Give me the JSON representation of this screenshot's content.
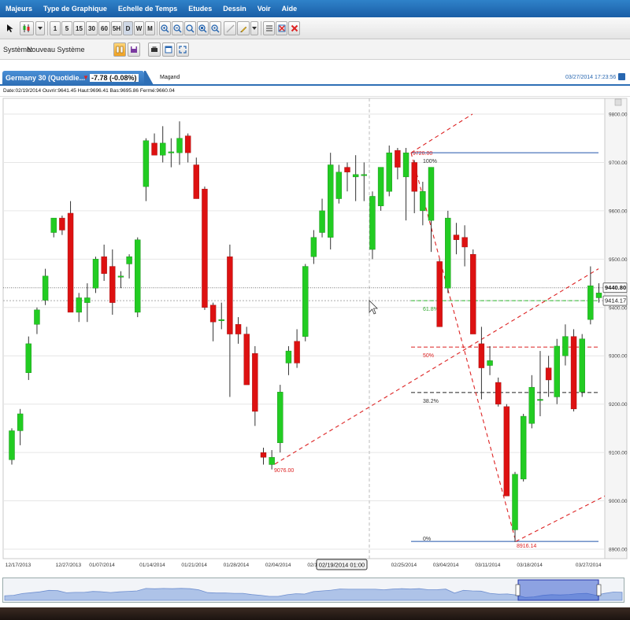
{
  "menu": [
    "Majeurs",
    "Type de Graphique",
    "Echelle de Temps",
    "Etudes",
    "Dessin",
    "Voir",
    "Aide"
  ],
  "toolbar": {
    "timeframes": [
      "1",
      "5",
      "15",
      "30",
      "60",
      "5H",
      "D",
      "W",
      "M"
    ]
  },
  "system": {
    "label": "Système:",
    "value": "Nouveau Système"
  },
  "tab": {
    "title": "Germany 30 (Quotidie...",
    "change": "-7.78 (-0.08%)",
    "second_tab": "Magand",
    "timestamp": "03/27/2014 17:23:56"
  },
  "info": {
    "text": "Date:02/19/2014 Ouvrir:9641.45 Haut:9696.41 Bas:9695.86 Fermé:9660.04"
  },
  "colors": {
    "up": "#22cc22",
    "down": "#dd1111",
    "fib": "#dd2222",
    "channel": "#2255aa"
  },
  "chart_data": {
    "type": "candlestick",
    "instrument": "Germany 30",
    "ylim": [
      8900,
      9800
    ],
    "y_ticks": [
      "9800.00",
      "9700.00",
      "9600.00",
      "9500.00",
      "9400.00",
      "9300.00",
      "9200.00",
      "9100.00",
      "9000.00",
      "8900.00"
    ],
    "x_ticks": [
      "12/17/2013",
      "12/27/2013",
      "01/07/2014",
      "01/14/2014",
      "01/21/2014",
      "01/28/2014",
      "02/04/2014",
      "02/11/2014",
      "02/25/2014",
      "03/04/2014",
      "03/11/2014",
      "03/18/2014",
      "03/27/2014"
    ],
    "candles": [
      {
        "o": 9085,
        "h": 9150,
        "l": 9075,
        "c": 9145
      },
      {
        "o": 9145,
        "h": 9190,
        "l": 9115,
        "c": 9180
      },
      {
        "o": 9265,
        "h": 9340,
        "l": 9250,
        "c": 9325
      },
      {
        "o": 9365,
        "h": 9400,
        "l": 9345,
        "c": 9395
      },
      {
        "o": 9415,
        "h": 9480,
        "l": 9405,
        "c": 9465
      },
      {
        "o": 9555,
        "h": 9585,
        "l": 9545,
        "c": 9585
      },
      {
        "o": 9585,
        "h": 9590,
        "l": 9550,
        "c": 9560
      },
      {
        "o": 9595,
        "h": 9620,
        "l": 9395,
        "c": 9390
      },
      {
        "o": 9390,
        "h": 9430,
        "l": 9370,
        "c": 9420
      },
      {
        "o": 9410,
        "h": 9450,
        "l": 9370,
        "c": 9420
      },
      {
        "o": 9440,
        "h": 9505,
        "l": 9430,
        "c": 9500
      },
      {
        "o": 9505,
        "h": 9530,
        "l": 9455,
        "c": 9470
      },
      {
        "o": 9485,
        "h": 9520,
        "l": 9385,
        "c": 9410
      },
      {
        "o": 9465,
        "h": 9475,
        "l": 9440,
        "c": 9465
      },
      {
        "o": 9490,
        "h": 9510,
        "l": 9460,
        "c": 9505
      },
      {
        "o": 9390,
        "h": 9545,
        "l": 9380,
        "c": 9540
      },
      {
        "o": 9650,
        "h": 9750,
        "l": 9620,
        "c": 9745
      },
      {
        "o": 9740,
        "h": 9760,
        "l": 9720,
        "c": 9715
      },
      {
        "o": 9715,
        "h": 9775,
        "l": 9700,
        "c": 9740
      },
      {
        "o": 9720,
        "h": 9750,
        "l": 9690,
        "c": 9722
      },
      {
        "o": 9720,
        "h": 9785,
        "l": 9695,
        "c": 9750
      },
      {
        "o": 9755,
        "h": 9760,
        "l": 9700,
        "c": 9720
      },
      {
        "o": 9695,
        "h": 9710,
        "l": 9625,
        "c": 9625
      },
      {
        "o": 9645,
        "h": 9650,
        "l": 9395,
        "c": 9400
      },
      {
        "o": 9405,
        "h": 9410,
        "l": 9330,
        "c": 9370
      },
      {
        "o": 9375,
        "h": 9410,
        "l": 9355,
        "c": 9375
      },
      {
        "o": 9505,
        "h": 9530,
        "l": 9215,
        "c": 9345
      },
      {
        "o": 9365,
        "h": 9380,
        "l": 9325,
        "c": 9345
      },
      {
        "o": 9345,
        "h": 9360,
        "l": 9265,
        "c": 9240
      },
      {
        "o": 9305,
        "h": 9320,
        "l": 9155,
        "c": 9185
      },
      {
        "o": 9100,
        "h": 9110,
        "l": 9075,
        "c": 9090
      },
      {
        "o": 9075,
        "h": 9105,
        "l": 9065,
        "c": 9090
      },
      {
        "o": 9120,
        "h": 9240,
        "l": 9100,
        "c": 9225
      },
      {
        "o": 9285,
        "h": 9320,
        "l": 9260,
        "c": 9310
      },
      {
        "o": 9330,
        "h": 9355,
        "l": 9275,
        "c": 9285
      },
      {
        "o": 9340,
        "h": 9490,
        "l": 9330,
        "c": 9485
      },
      {
        "o": 9505,
        "h": 9560,
        "l": 9490,
        "c": 9545
      },
      {
        "o": 9555,
        "h": 9625,
        "l": 9545,
        "c": 9600
      },
      {
        "o": 9545,
        "h": 9720,
        "l": 9520,
        "c": 9695
      },
      {
        "o": 9625,
        "h": 9695,
        "l": 9615,
        "c": 9680
      },
      {
        "o": 9690,
        "h": 9700,
        "l": 9640,
        "c": 9680
      },
      {
        "o": 9670,
        "h": 9715,
        "l": 9620,
        "c": 9675
      },
      {
        "o": 9675,
        "h": 9700,
        "l": 9620,
        "c": 9675
      },
      {
        "o": 9520,
        "h": 9640,
        "l": 9500,
        "c": 9630
      },
      {
        "o": 9610,
        "h": 9690,
        "l": 9600,
        "c": 9690
      },
      {
        "o": 9640,
        "h": 9735,
        "l": 9630,
        "c": 9720
      },
      {
        "o": 9725,
        "h": 9730,
        "l": 9665,
        "c": 9690
      },
      {
        "o": 9670,
        "h": 9730,
        "l": 9580,
        "c": 9720
      },
      {
        "o": 9700,
        "h": 9705,
        "l": 9595,
        "c": 9640
      },
      {
        "o": 9600,
        "h": 9660,
        "l": 9570,
        "c": 9640
      },
      {
        "o": 9580,
        "h": 9690,
        "l": 9515,
        "c": 9690
      },
      {
        "o": 9495,
        "h": 9500,
        "l": 9360,
        "c": 9360
      },
      {
        "o": 9440,
        "h": 9600,
        "l": 9430,
        "c": 9585
      },
      {
        "o": 9550,
        "h": 9575,
        "l": 9510,
        "c": 9540
      },
      {
        "o": 9545,
        "h": 9570,
        "l": 9485,
        "c": 9525
      },
      {
        "o": 9510,
        "h": 9520,
        "l": 9350,
        "c": 9345
      },
      {
        "o": 9325,
        "h": 9360,
        "l": 9210,
        "c": 9275
      },
      {
        "o": 9280,
        "h": 9320,
        "l": 9260,
        "c": 9290
      },
      {
        "o": 9245,
        "h": 9255,
        "l": 9195,
        "c": 9200
      },
      {
        "o": 9195,
        "h": 9200,
        "l": 9010,
        "c": 9010
      },
      {
        "o": 8940,
        "h": 9060,
        "l": 8915,
        "c": 9055
      },
      {
        "o": 9045,
        "h": 9180,
        "l": 9040,
        "c": 9175
      },
      {
        "o": 9160,
        "h": 9260,
        "l": 9150,
        "c": 9235
      },
      {
        "o": 9210,
        "h": 9310,
        "l": 9175,
        "c": 9210
      },
      {
        "o": 9275,
        "h": 9300,
        "l": 9215,
        "c": 9250
      },
      {
        "o": 9215,
        "h": 9335,
        "l": 9200,
        "c": 9320
      },
      {
        "o": 9300,
        "h": 9365,
        "l": 9280,
        "c": 9340
      },
      {
        "o": 9340,
        "h": 9355,
        "l": 9185,
        "c": 9190
      },
      {
        "o": 9225,
        "h": 9345,
        "l": 9215,
        "c": 9335
      },
      {
        "o": 9375,
        "h": 9485,
        "l": 9365,
        "c": 9445
      },
      {
        "o": 9420,
        "h": 9450,
        "l": 9410,
        "c": 9430
      }
    ],
    "fib_levels": [
      {
        "label": "100%",
        "value": 9720.0
      },
      {
        "label": "61.8%",
        "value": 9414.17
      },
      {
        "label": "50%",
        "value": 9318
      },
      {
        "label": "38.2%",
        "value": 9224
      },
      {
        "label": "0%",
        "value": 8916.14
      }
    ],
    "annotations": [
      {
        "text": "9720.00",
        "value": 9720.0
      },
      {
        "text": "9076.00",
        "value": 9076.0
      },
      {
        "text": "8916.14",
        "value": 8916.14
      }
    ],
    "price_labels": [
      {
        "text": "9440.80",
        "value": 9440.8
      },
      {
        "text": "9414.17",
        "value": 9414.17
      }
    ],
    "crosshair_label": "02/19/2014 01:00"
  }
}
